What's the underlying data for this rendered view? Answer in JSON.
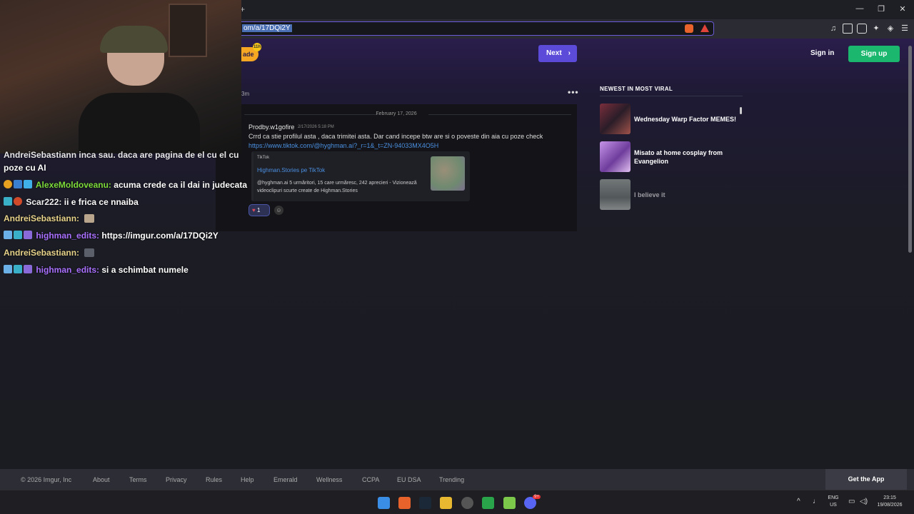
{
  "browser": {
    "new_tab": "+",
    "url": "om/a/17DQi2Y",
    "window_controls": [
      "—",
      "❐",
      "✕"
    ]
  },
  "imgur": {
    "badge_text": "ade",
    "badge_count": "11h",
    "next_label": "Next",
    "sign_in": "Sign in",
    "sign_up": "Sign up",
    "post_meta": "3m",
    "sidebar_heading": "NEWEST IN MOST VIRAL",
    "viral": [
      {
        "title": "Wednesday Warp Factor MEMES!",
        "thumb_color": "#5b2a3a"
      },
      {
        "title": "Misato at home cosplay from Evangelion",
        "thumb_color": "#9b6ac8"
      },
      {
        "title": "I believe it",
        "thumb_color": "#9aa19c"
      }
    ],
    "footer": [
      "© 2026 Imgur, Inc",
      "About",
      "Terms",
      "Privacy",
      "Rules",
      "Help",
      "Emerald",
      "Wellness",
      "CCPA",
      "EU DSA",
      "Trending"
    ],
    "get_app": "Get the App"
  },
  "discord": {
    "date": "February 17, 2026",
    "user": "Prodby.w1gofire",
    "timestamp": "2/17/2026 5:18 PM",
    "message": "Crrd ca stie profilul asta , daca trimitei asta.  Dar cand incepe  btw are si o poveste din aia cu poze check",
    "link": "https://www.tiktok.com/@hyghman.ai?_r=1&_t=ZN-94033MX4O5H",
    "embed_source": "TikTok",
    "embed_title": "Highman.Stories pe TikTok",
    "embed_desc": "@hyghman.ai 5 urmăritori, 15 care urmăresc, 242 aprecieri - Vizionează videoclipuri scurte create de Highman.Stories",
    "reaction_count": "1"
  },
  "chat": [
    {
      "user": "",
      "text": "poze cu AI",
      "color": "plain"
    },
    {
      "user": "AlexeMoldoveanu:",
      "text": "acuma crede ca il dai in judecata",
      "color": "green"
    },
    {
      "user": "Scar222:",
      "text": "ii e frica ce nnaiba",
      "color": "plain"
    },
    {
      "user": "AndreiSebastiann:",
      "text": "",
      "color": "tan"
    },
    {
      "user": "highman_edits:",
      "text": "https://imgur.com/a/17DQi2Y",
      "color": "purple"
    },
    {
      "user": "AndreiSebastiann:",
      "text": "",
      "color": "tan"
    },
    {
      "user": "highman_edits:",
      "text": "si a schimbat numele",
      "color": "purple"
    }
  ],
  "chat_partial": "AndreiSebastiann inca sau. daca are pagina de el cu el cu",
  "taskbar": {
    "lang_top": "ENG",
    "lang_bottom": "US",
    "time": "23:15",
    "date": "19/08/2026",
    "discord_badge": "9+"
  }
}
